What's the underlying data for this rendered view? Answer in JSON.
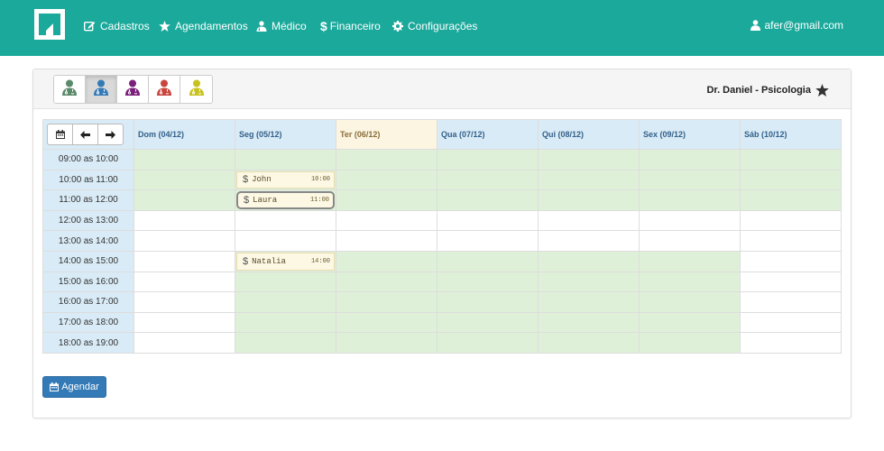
{
  "navbar": {
    "items": [
      {
        "label": "Cadastros",
        "icon": "edit-icon"
      },
      {
        "label": "Agendamentos",
        "icon": "star-icon"
      },
      {
        "label": "Médico",
        "icon": "doctor-icon"
      },
      {
        "label": "Financeiro",
        "icon": "dollar-icon"
      },
      {
        "label": "Configurações",
        "icon": "gear-icon"
      }
    ],
    "user_email": "afer@gmail.com"
  },
  "doctor_selector": {
    "colors": [
      "#5b8a6a",
      "#337ab7",
      "#7b1f7a",
      "#c9453e",
      "#c9c21e"
    ],
    "active_index": 1
  },
  "doctor_name": "Dr. Daniel - Psicologia",
  "calendar": {
    "days": [
      "Dom (04/12)",
      "Seg (05/12)",
      "Ter (06/12)",
      "Qua (07/12)",
      "Qui (08/12)",
      "Sex (09/12)",
      "Sáb (10/12)"
    ],
    "today_index": 2,
    "times": [
      "09:00 as 10:00",
      "10:00 as 11:00",
      "11:00 as 12:00",
      "12:00 as 13:00",
      "13:00 as 14:00",
      "14:00 as 15:00",
      "15:00 as 16:00",
      "16:00 as 17:00",
      "17:00 as 18:00",
      "18:00 as 19:00"
    ],
    "appointments": [
      {
        "name": "John",
        "time": "10:00"
      },
      {
        "name": "Laura",
        "time": "11:00"
      },
      {
        "name": "Natalia",
        "time": "14:00"
      }
    ]
  },
  "agendar_label": "Agendar",
  "colors": {
    "navbar": "#1ba99b",
    "available": "#dff0d8",
    "header": "#d9ebf6",
    "today": "#fcf5e1",
    "appointment": "#fcf8e3",
    "primary": "#337ab7"
  }
}
